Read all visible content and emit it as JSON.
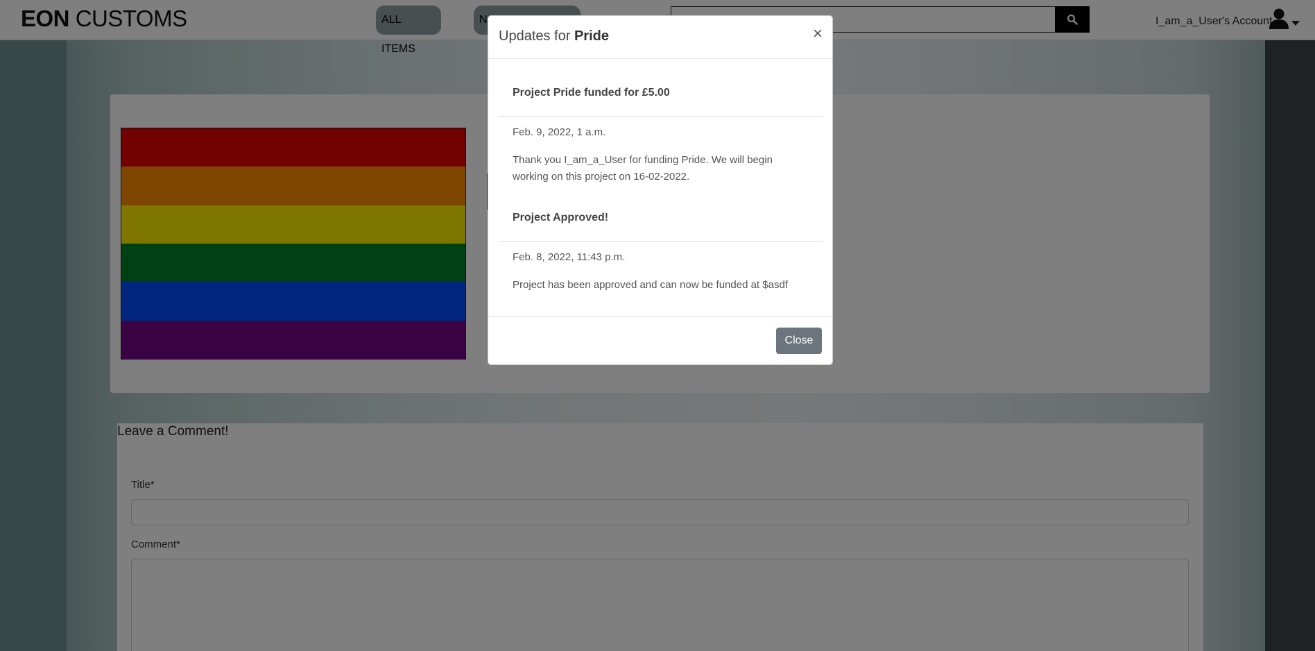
{
  "navbar": {
    "brand_bold": "EON",
    "brand_rest": "CUSTOMS",
    "nav_all_items": "ALL ITEMS",
    "nav_second_partial": "N",
    "search_value": "",
    "account_label": "I_am_a_User's Account"
  },
  "icons": {
    "search": "search-icon",
    "account": "user-icon",
    "caret": "caret-down-icon"
  },
  "product": {
    "flag_colors": [
      "#e40303",
      "#ff8c00",
      "#ffed00",
      "#008026",
      "#004dff",
      "#750787"
    ]
  },
  "comment_form": {
    "heading": "Leave a Comment!",
    "title_label": "Title*",
    "comment_label": "Comment*",
    "title_value": "",
    "comment_value": ""
  },
  "modal": {
    "title_prefix": "Updates for ",
    "title_project": "Pride",
    "close_x": "×",
    "updates": [
      {
        "title": "Project Pride funded for £5.00",
        "date": "Feb. 9, 2022, 1 a.m.",
        "body": "Thank you I_am_a_User for funding Pride. We will begin working on this project on 16-02-2022."
      },
      {
        "title": "Project Approved!",
        "date": "Feb. 8, 2022, 11:43 p.m.",
        "body": "Project has been approved and can now be funded at $asdf"
      }
    ],
    "close_button": "Close"
  }
}
